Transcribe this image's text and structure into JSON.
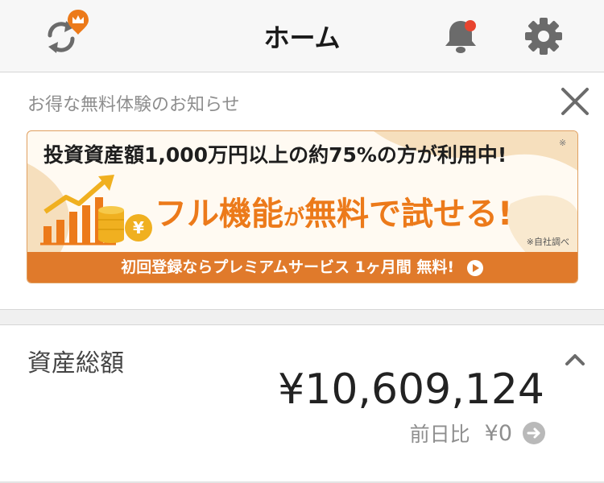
{
  "header": {
    "title": "ホーム",
    "icons": {
      "sync": "sync-icon",
      "crown": "crown-badge-icon",
      "bell": "bell-icon",
      "gear": "gear-icon"
    },
    "notification_dot": true
  },
  "notice": {
    "title": "お得な無料体験のお知らせ",
    "close_icon": "close-icon",
    "banner": {
      "headline": "投資資産額1,000万円以上の約75%の方が利用中!",
      "asterisk": "※",
      "main_part1": "フル機能",
      "main_part2": "が",
      "main_part3": "無料で試せる!",
      "note": "※自社調べ",
      "strip_text": "初回登録ならプレミアムサービス 1ヶ月間 無料!"
    }
  },
  "assets": {
    "label": "資産総額",
    "value": "¥10,609,124",
    "change_label": "前日比",
    "change_value": "¥0"
  },
  "colors": {
    "accent_orange": "#e07a2b",
    "banner_main": "#ec7a1a",
    "badge_red": "#e8442f",
    "muted_gray": "#8e8e8e",
    "icon_gray": "#6b6b6b"
  }
}
